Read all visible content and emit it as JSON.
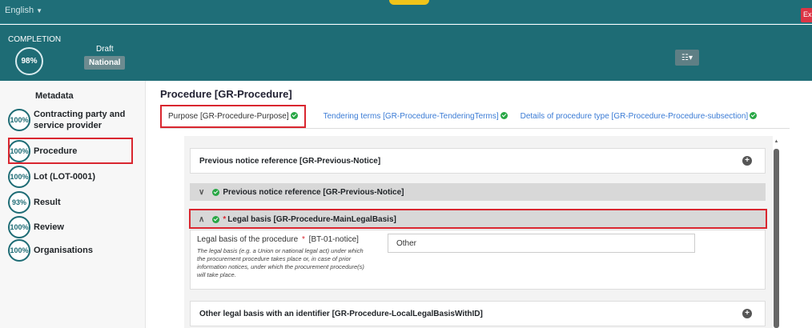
{
  "topbar": {
    "language": "English",
    "exit_label": "Ex"
  },
  "header": {
    "completion_title": "COMPLETION",
    "completion_pct": "98%",
    "status": "Draft",
    "scope": "National"
  },
  "sidebar": {
    "heading": "Metadata",
    "items": [
      {
        "pct": "100%",
        "label": "Contracting party and service provider"
      },
      {
        "pct": "100%",
        "label": "Procedure"
      },
      {
        "pct": "100%",
        "label": "Lot (LOT-0001)"
      },
      {
        "pct": "93%",
        "label": "Result"
      },
      {
        "pct": "100%",
        "label": "Review"
      },
      {
        "pct": "100%",
        "label": "Organisations"
      }
    ],
    "active_index": 1
  },
  "main": {
    "title": "Procedure [GR-Procedure]",
    "tabs": [
      {
        "label": "Purpose [GR-Procedure-Purpose]"
      },
      {
        "label": "Tendering terms [GR-Procedure-TenderingTerms]"
      },
      {
        "label": "Details of procedure type [GR-Procedure-Procedure-subsection]"
      }
    ],
    "sections": {
      "previous_notice_card": "Previous notice reference [GR-Previous-Notice]",
      "previous_notice_group": "Previous notice reference [GR-Previous-Notice]",
      "legal_basis_group": "Legal basis [GR-Procedure-MainLegalBasis]",
      "legal_basis_field_label": "Legal basis of the procedure",
      "legal_basis_field_code": "[BT-01-notice]",
      "legal_basis_help": "The legal basis (e.g. a Union or national legal act) under which the procurement procedure takes place or, in case of prior information notices, under which the procurement procedure(s) will take place.",
      "legal_basis_value": "Other",
      "other_legal_basis_card": "Other legal basis with an identifier [GR-Procedure-LocalLegalBasisWithID]"
    }
  },
  "colors": {
    "accent": "#1e6c75",
    "highlight": "#d9262f",
    "ok": "#28a745",
    "link": "#3a7bd5"
  }
}
